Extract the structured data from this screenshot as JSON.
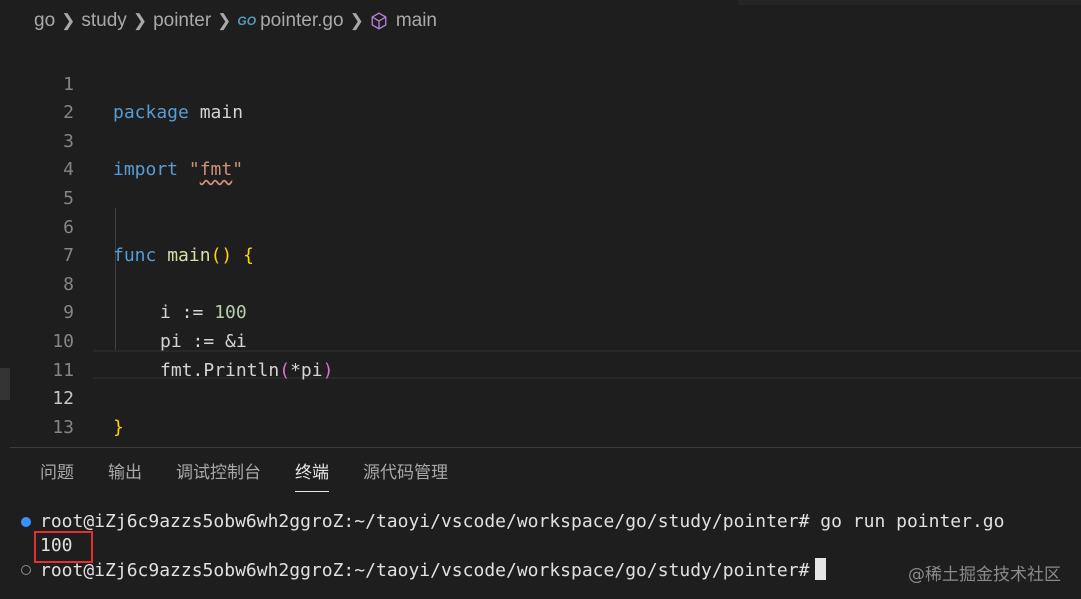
{
  "breadcrumb": {
    "items": [
      "go",
      "study",
      "pointer"
    ],
    "file_icon": "GO",
    "file_name": "pointer.go",
    "symbol": "main"
  },
  "editor": {
    "lines": [
      {
        "n": "1"
      },
      {
        "n": "2"
      },
      {
        "n": "3"
      },
      {
        "n": "4"
      },
      {
        "n": "5"
      },
      {
        "n": "6"
      },
      {
        "n": "7"
      },
      {
        "n": "8"
      },
      {
        "n": "9"
      },
      {
        "n": "10"
      },
      {
        "n": "11"
      },
      {
        "n": "12"
      },
      {
        "n": "13"
      }
    ],
    "active_line": "12",
    "tokens": {
      "package_kw": "package",
      "package_name": "main",
      "import_kw": "import",
      "import_q1": "\"",
      "import_str": "fmt",
      "import_q2": "\"",
      "func_kw": "func",
      "func_name": "main",
      "func_parens": "()",
      "open_brace": "{",
      "l8_var": "i",
      "l8_op": " := ",
      "l8_num": "100",
      "l9": "pi := &i",
      "l10_pkg": "fmt.",
      "l10_fn": "Println",
      "l10_open": "(",
      "l10_arg": "*pi",
      "l10_close": ")",
      "close_brace": "}"
    }
  },
  "panel": {
    "tabs": [
      "问题",
      "输出",
      "调试控制台",
      "终端",
      "源代码管理"
    ],
    "active_tab": "终端"
  },
  "terminal": {
    "line1": "root@iZj6c9azzs5obw6wh2ggroZ:~/taoyi/vscode/workspace/go/study/pointer# go run pointer.go",
    "line2": "100",
    "line3": "root@iZj6c9azzs5obw6wh2ggroZ:~/taoyi/vscode/workspace/go/study/pointer#"
  },
  "watermark": "@稀土掘金技术社区",
  "colors": {
    "keyword": "#569cd6",
    "function": "#dcdcaa",
    "string": "#ce9178",
    "number": "#b5cea8",
    "brace": "#ffd700",
    "highlight_box": "#e03030"
  }
}
